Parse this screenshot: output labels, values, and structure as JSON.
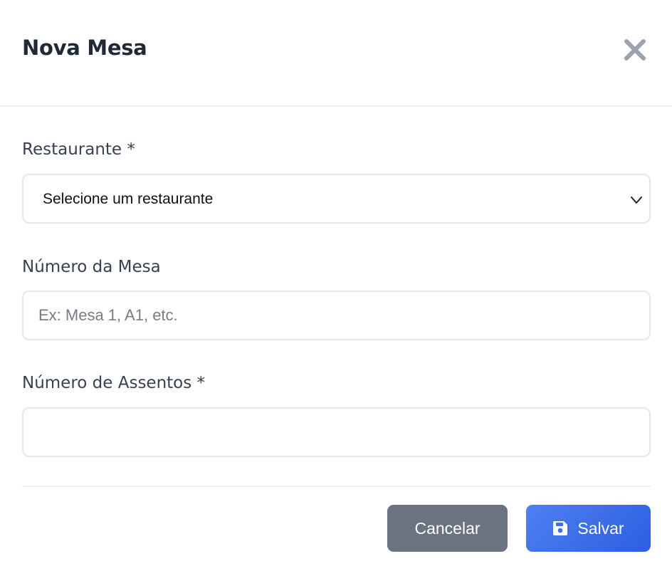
{
  "modal": {
    "title": "Nova Mesa",
    "close_icon": "close-icon"
  },
  "form": {
    "restaurant": {
      "label": "Restaurante *",
      "selected": "Selecione um restaurante",
      "icon": "chevron-down-icon"
    },
    "table_number": {
      "label": "Número da Mesa",
      "placeholder": "Ex: Mesa 1, A1, etc.",
      "value": ""
    },
    "seats": {
      "label": "Número de Assentos *",
      "placeholder": "",
      "value": ""
    }
  },
  "footer": {
    "cancel_label": "Cancelar",
    "save_label": "Salvar",
    "save_icon": "floppy-disk-icon"
  },
  "colors": {
    "title": "#1f2937",
    "label": "#374151",
    "border": "#e5e7eb",
    "cancel_button": "#6b7280",
    "save_button": "#3b6ef0",
    "close_icon": "#9ca3af"
  }
}
